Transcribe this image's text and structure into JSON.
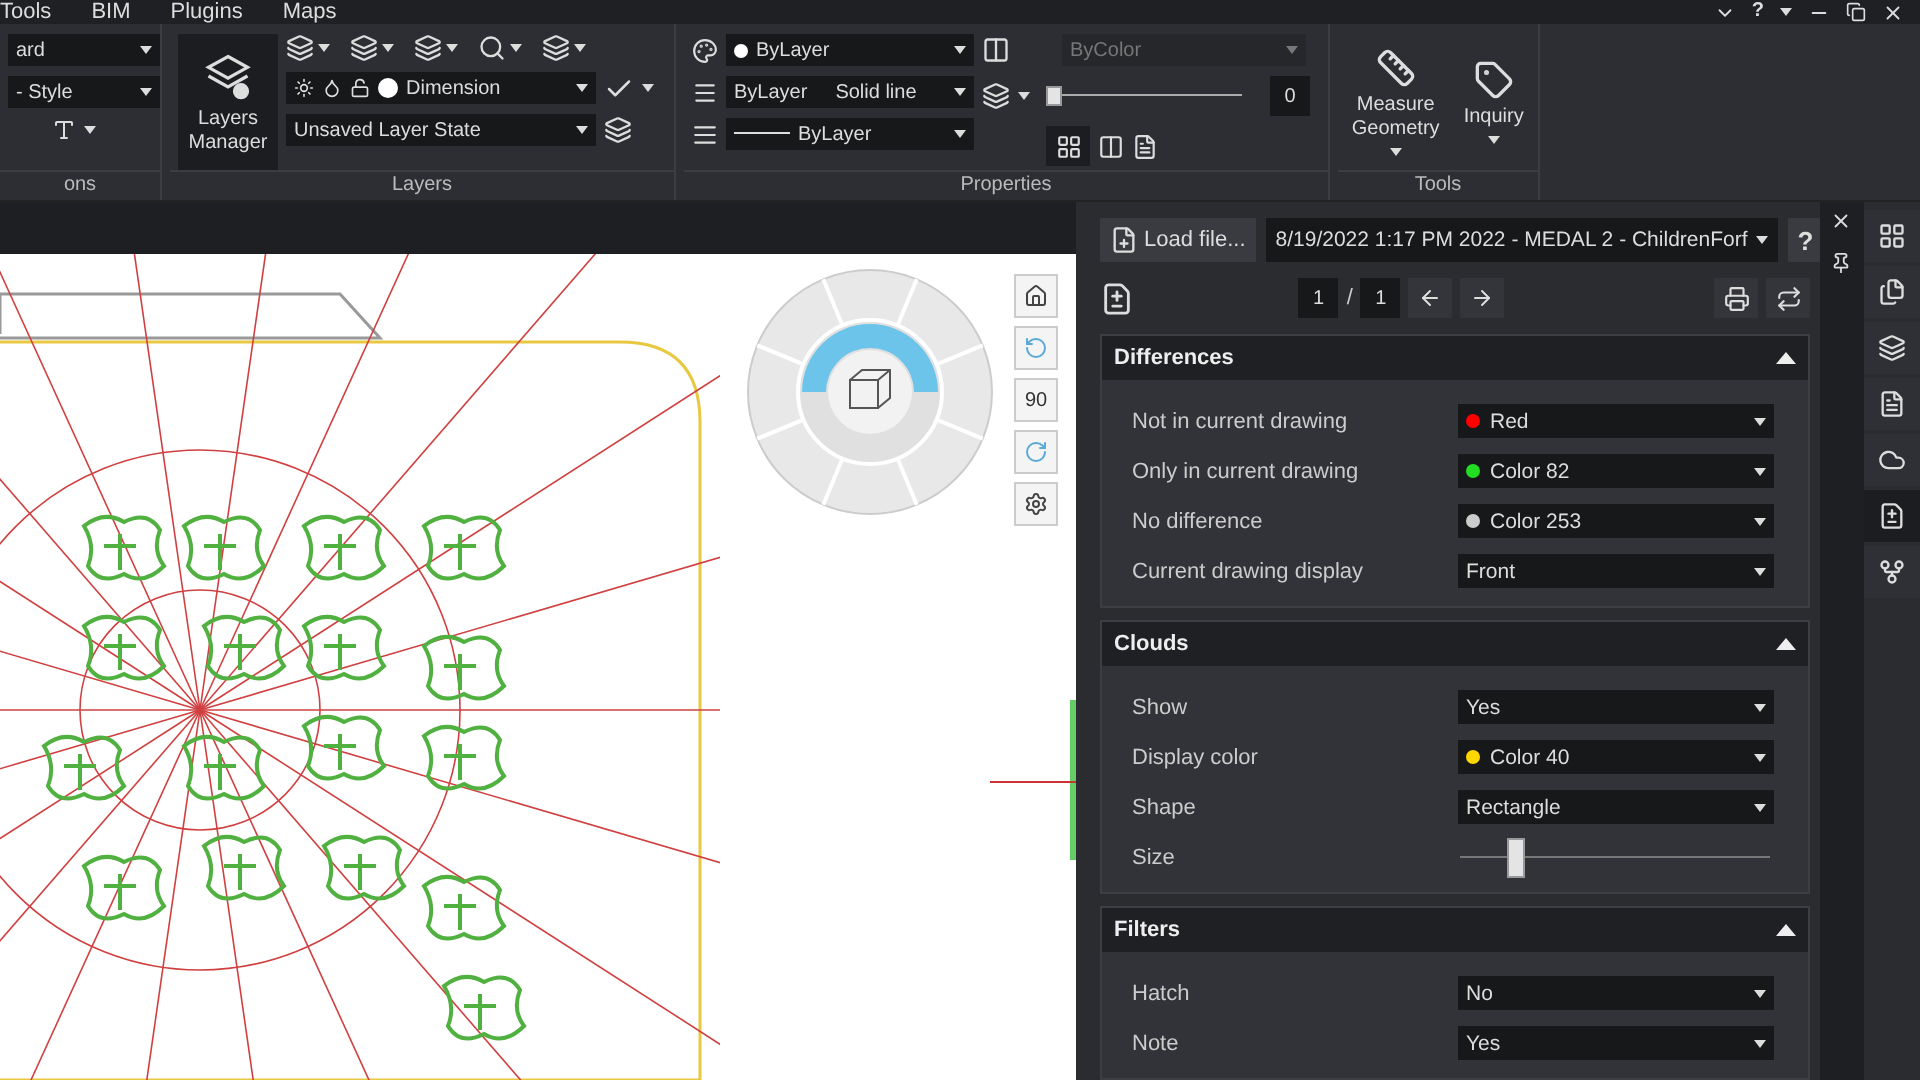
{
  "menu": [
    "Tools",
    "BIM",
    "Plugins",
    "Maps"
  ],
  "window_controls": {
    "help": "?"
  },
  "ribbon": {
    "partial_panel": {
      "fields": [
        "ard",
        "- Style"
      ],
      "footer": "ons"
    },
    "layers": {
      "manager": "Layers Manager",
      "layer": "Dimension",
      "layer_state": "Unsaved Layer State",
      "footer": "Layers"
    },
    "properties": {
      "color_setting": "ByLayer",
      "linetype": [
        "ByLayer",
        "Solid line"
      ],
      "lineweight": "ByLayer",
      "plot_style": {
        "value": "ByColor",
        "disabled": true
      },
      "transparency": {
        "value": "0",
        "level": 0
      },
      "footer": "Properties"
    },
    "tools": {
      "buttons": [
        {
          "label": "Measure Geometry",
          "kind": "ruler"
        },
        {
          "label": "Inquiry",
          "kind": "tape"
        }
      ],
      "footer": "Tools"
    }
  },
  "viewcube": {
    "rotation": "90"
  },
  "compare": {
    "load_button": "Load file...",
    "file": "8/19/2022 1:17 PM 2022 - MEDAL 2 - ChildrenForf",
    "help": "?",
    "page": "1",
    "page_separator": "/",
    "page_count": "1",
    "sections": [
      {
        "title": "Differences",
        "expanded": true,
        "rows": [
          {
            "label": "Not in current drawing",
            "kind": "select",
            "value": "Red",
            "color": "#ff0000"
          },
          {
            "label": "Only in current drawing",
            "kind": "select",
            "value": "Color 82",
            "color": "#22dd22"
          },
          {
            "label": "No difference",
            "kind": "select",
            "value": "Color 253",
            "color": "#cccccc"
          },
          {
            "label": "Current drawing display",
            "kind": "select",
            "value": "Front"
          }
        ]
      },
      {
        "title": "Clouds",
        "expanded": true,
        "rows": [
          {
            "label": "Show",
            "kind": "select",
            "value": "Yes"
          },
          {
            "label": "Display color",
            "kind": "select",
            "value": "Color 40",
            "color": "#ffd700"
          },
          {
            "label": "Shape",
            "kind": "select",
            "value": "Rectangle"
          },
          {
            "label": "Size",
            "kind": "slider",
            "level": 0.18
          }
        ]
      },
      {
        "title": "Filters",
        "expanded": true,
        "rows": [
          {
            "label": "Hatch",
            "kind": "select",
            "value": "No"
          },
          {
            "label": "Note",
            "kind": "select",
            "value": "Yes"
          }
        ]
      }
    ]
  },
  "side_tools": [
    {
      "kind": "properties",
      "selected": false
    },
    {
      "kind": "sheets",
      "selected": false
    },
    {
      "kind": "layers",
      "selected": false
    },
    {
      "kind": "file",
      "selected": false
    },
    {
      "kind": "cloud",
      "selected": false
    },
    {
      "kind": "compare",
      "selected": true
    },
    {
      "kind": "branch",
      "selected": false
    }
  ]
}
